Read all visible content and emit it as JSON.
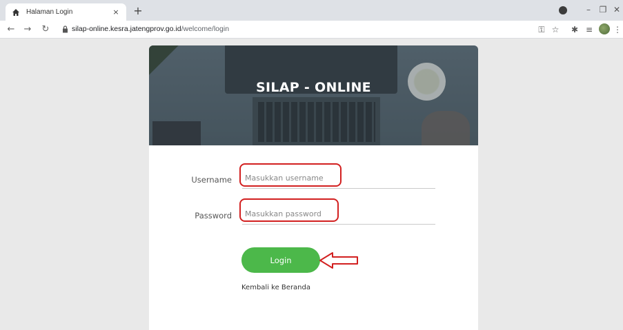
{
  "browser": {
    "tab_title": "Halaman Login",
    "tab_close": "×",
    "new_tab": "+",
    "url_host": "silap-online.kesra.jatengprov.go.id",
    "url_path": "/welcome/login",
    "minimize": "–",
    "restore": "❐",
    "close": "✕"
  },
  "hero": {
    "title": "SILAP - ONLINE"
  },
  "form": {
    "username_label": "Username",
    "username_placeholder": "Masukkan username",
    "password_label": "Password",
    "password_placeholder": "Masukkan password",
    "login_label": "Login",
    "back_link": "Kembali ke Beranda"
  },
  "colors": {
    "login_button": "#4cb84a",
    "highlight_red": "#d21f1f"
  }
}
